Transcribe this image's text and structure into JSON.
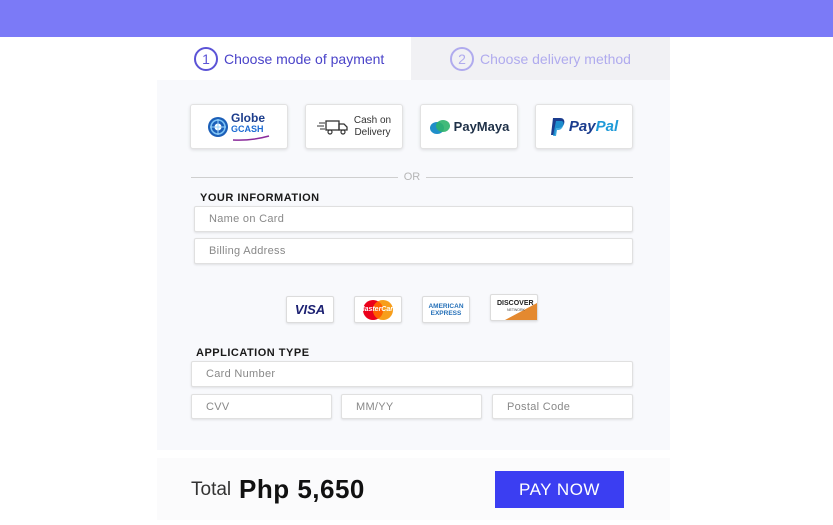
{
  "header": {
    "bar_color": "#7b7af7"
  },
  "steps": [
    {
      "number": "1",
      "label": "Choose mode of payment",
      "active": true
    },
    {
      "number": "2",
      "label": "Choose delivery method",
      "active": false
    }
  ],
  "payment_options": {
    "globe": {
      "brand": "Globe",
      "sub": "GCASH",
      "icon": "globe-gcash-icon"
    },
    "cod": {
      "line1": "Cash on",
      "line2": "Delivery",
      "icon": "delivery-truck-icon"
    },
    "paymaya": {
      "label": "PayMaya",
      "icon": "paymaya-icon"
    },
    "paypal": {
      "label_pay": "Pay",
      "label_pal": "Pal",
      "icon": "paypal-icon"
    }
  },
  "divider": {
    "text": "OR"
  },
  "your_information": {
    "title": "YOUR INFORMATION",
    "name_placeholder": "Name on Card",
    "billing_placeholder": "Billing Address"
  },
  "cards": {
    "visa": "VISA",
    "mastercard": "MasterCard",
    "amex_line1": "AMERICAN",
    "amex_line2": "EXPRESS",
    "discover": "DISCOVER",
    "discover_sub": "NETWORK"
  },
  "application_type": {
    "title": "APPLICATION TYPE",
    "card_number_placeholder": "Card Number",
    "cvv_placeholder": "CVV",
    "expiry_placeholder": "MM/YY",
    "postal_placeholder": "Postal Code"
  },
  "footer": {
    "total_label": "Total",
    "total_amount": "Php 5,650",
    "pay_button": "PAY NOW",
    "accent": "#3b3ef2"
  }
}
